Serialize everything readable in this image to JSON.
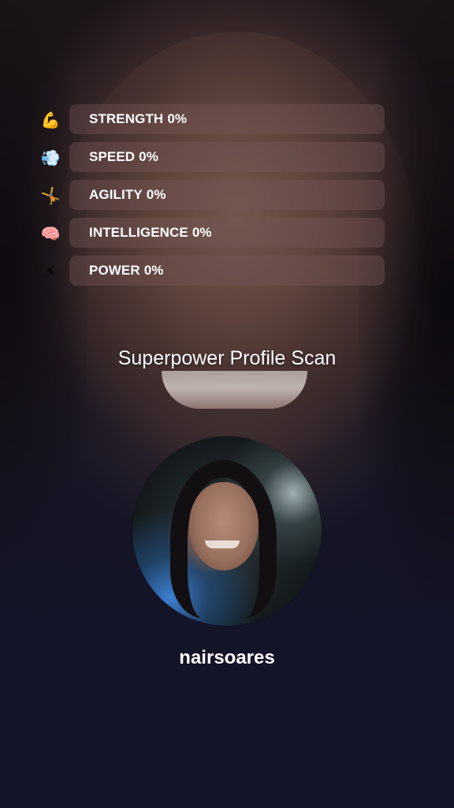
{
  "stats": [
    {
      "icon": "💪",
      "icon_name": "flexed-biceps-icon",
      "label": "STRENGTH",
      "percent": "0%",
      "value": 0
    },
    {
      "icon": "💨",
      "icon_name": "dash-wind-icon",
      "label": "SPEED",
      "percent": "0%",
      "value": 0
    },
    {
      "icon": "🤸",
      "icon_name": "cartwheel-person-icon",
      "label": "AGILITY",
      "percent": "0%",
      "value": 0
    },
    {
      "icon": "🧠",
      "icon_name": "brain-icon",
      "label": "INTELLIGENCE",
      "percent": "0%",
      "value": 0
    },
    {
      "icon": "⚡",
      "icon_name": "lightning-bolt-icon",
      "label": "POWER",
      "percent": "0%",
      "value": 0
    }
  ],
  "scan": {
    "title": "Superpower Profile Scan"
  },
  "profile": {
    "username": "nairsoares"
  },
  "colors": {
    "bar_background": "#785a5a",
    "text": "#ffffff"
  }
}
